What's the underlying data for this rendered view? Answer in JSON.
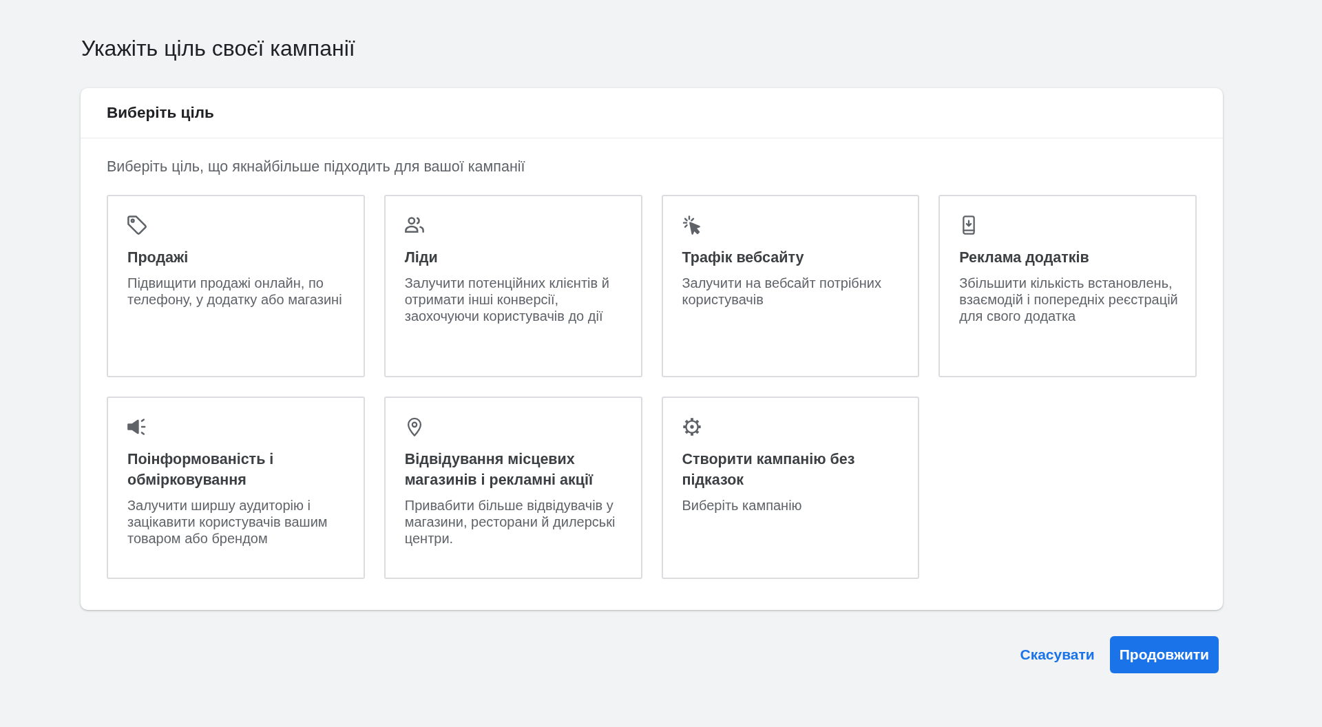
{
  "page_title": "Укажіть ціль своєї кампанії",
  "panel": {
    "header": "Виберіть ціль",
    "subtitle": "Виберіть ціль, що якнайбільше підходить для вашої кампанії",
    "goals": [
      {
        "kind": "sales",
        "title": "Продажі",
        "description": "Підвищити продажі онлайн, по телефону, у додатку або магазині"
      },
      {
        "kind": "leads",
        "title": "Ліди",
        "description": "Залучити потенційних клієнтів й отримати інші конверсії, заохочуючи користувачів до дії"
      },
      {
        "kind": "traffic",
        "title": "Трафік вебсайту",
        "description": "Залучити на вебсайт потрібних користувачів"
      },
      {
        "kind": "app",
        "title": "Реклама додатків",
        "description": "Збільшити кількість встановлень, взаємодій і попередніх реєстрацій для свого додатка"
      },
      {
        "kind": "awareness",
        "title": "Поінформованість і обмірковування",
        "description": "Залучити ширшу аудиторію і зацікавити користувачів вашим товаром або брендом"
      },
      {
        "kind": "local",
        "title": "Відвідування місцевих магазинів і рекламні акції",
        "description": "Привабити більше відвідувачів у магазини, ресторани й дилерські центри."
      },
      {
        "kind": "custom",
        "title": "Створити кампанію без підказок",
        "description": "Виберіть кампанію"
      }
    ]
  },
  "actions": {
    "cancel": "Скасувати",
    "continue": "Продовжити"
  }
}
